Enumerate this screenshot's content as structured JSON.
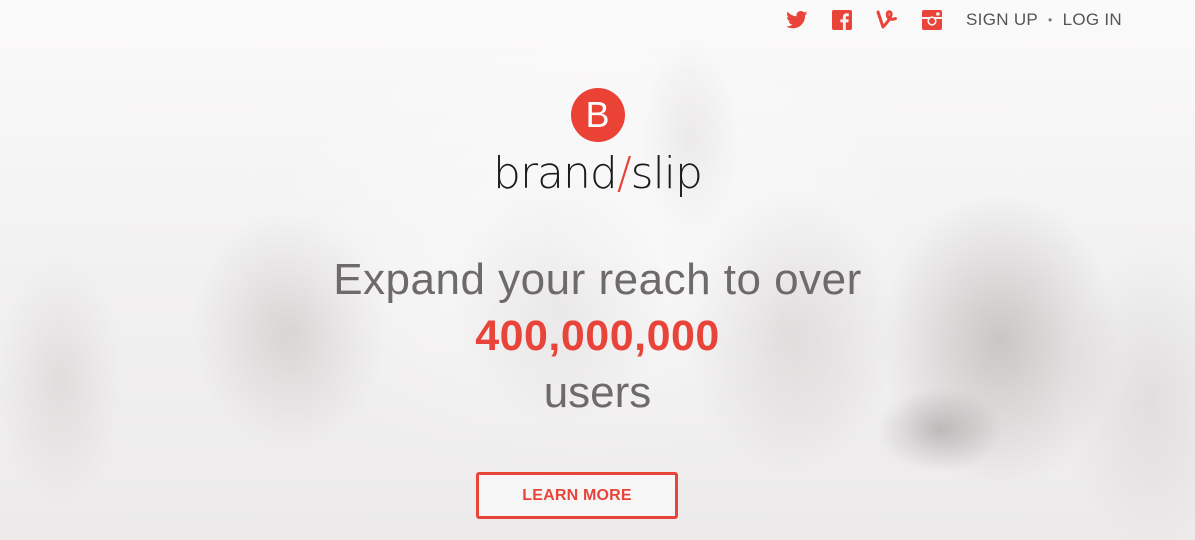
{
  "nav": {
    "social": [
      {
        "name": "twitter-icon",
        "color": "#e9443a"
      },
      {
        "name": "facebook-icon",
        "color": "#e9443a"
      },
      {
        "name": "vine-icon",
        "color": "#e9443a"
      },
      {
        "name": "instagram-icon",
        "color": "#e9443a"
      }
    ],
    "sign_up": "SIGN UP",
    "separator": "•",
    "log_in": "LOG IN"
  },
  "logo": {
    "mark_letter": "B",
    "word_left": "brand",
    "slash": "/",
    "word_right": "slip",
    "accent_color": "#ea4235"
  },
  "headline": {
    "line1": "Expand your reach to over",
    "line2": "400,000,000",
    "line3": "users"
  },
  "cta": {
    "label": "LEARN MORE"
  }
}
